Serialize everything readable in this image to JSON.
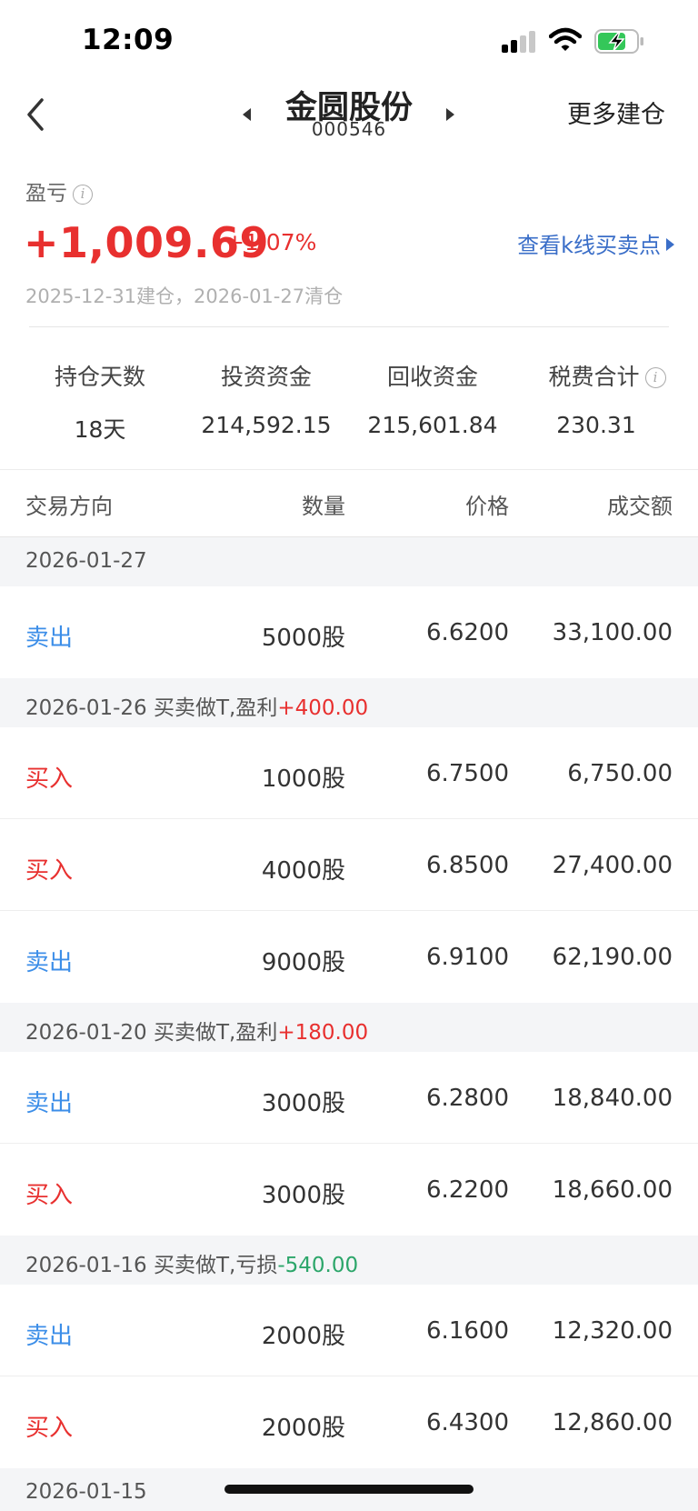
{
  "status_bar": {
    "time": "12:09"
  },
  "nav": {
    "stock_name": "金圆股份",
    "stock_code": "000546",
    "more_label": "更多建仓"
  },
  "profit": {
    "label": "盈亏",
    "amount": "+1,009.69",
    "percent": "+1.07%",
    "kline_link": "查看k线买卖点",
    "dates": "2025-12-31建仓，2026-01-27清仓"
  },
  "stats": [
    {
      "label": "持仓天数",
      "value": "18天"
    },
    {
      "label": "投资资金",
      "value": "214,592.15"
    },
    {
      "label": "回收资金",
      "value": "215,601.84"
    },
    {
      "label": "税费合计",
      "value": "230.31"
    }
  ],
  "table_header": {
    "direction": "交易方向",
    "quantity": "数量",
    "price": "价格",
    "amount": "成交额"
  },
  "groups": [
    {
      "date": "2026-01-27",
      "note": "",
      "profit": "",
      "rows": [
        {
          "dir": "卖出",
          "qty": "5000股",
          "price": "6.6200",
          "amount": "33,100.00"
        }
      ]
    },
    {
      "date": "2026-01-26",
      "note": " 买卖做T,盈利",
      "profit": "+400.00",
      "rows": [
        {
          "dir": "买入",
          "qty": "1000股",
          "price": "6.7500",
          "amount": "6,750.00"
        },
        {
          "dir": "买入",
          "qty": "4000股",
          "price": "6.8500",
          "amount": "27,400.00"
        },
        {
          "dir": "卖出",
          "qty": "9000股",
          "price": "6.9100",
          "amount": "62,190.00"
        }
      ]
    },
    {
      "date": "2026-01-20",
      "note": " 买卖做T,盈利",
      "profit": "+180.00",
      "rows": [
        {
          "dir": "卖出",
          "qty": "3000股",
          "price": "6.2800",
          "amount": "18,840.00"
        },
        {
          "dir": "买入",
          "qty": "3000股",
          "price": "6.2200",
          "amount": "18,660.00"
        }
      ]
    },
    {
      "date": "2026-01-16",
      "note": " 买卖做T,亏损",
      "profit": "-540.00",
      "rows": [
        {
          "dir": "卖出",
          "qty": "2000股",
          "price": "6.1600",
          "amount": "12,320.00"
        },
        {
          "dir": "买入",
          "qty": "2000股",
          "price": "6.4300",
          "amount": "12,860.00"
        }
      ]
    },
    {
      "date": "2026-01-15",
      "note": "",
      "profit": "",
      "rows": []
    }
  ],
  "colors": {
    "up": "#e8302f",
    "down": "#2ca66a",
    "sell": "#3c8ee8",
    "link": "#3a6ec8"
  },
  "icons": [
    "back-chevron-icon",
    "prev-triangle-icon",
    "next-triangle-icon",
    "info-icon",
    "signal-icon",
    "wifi-icon",
    "battery-charging-icon"
  ]
}
